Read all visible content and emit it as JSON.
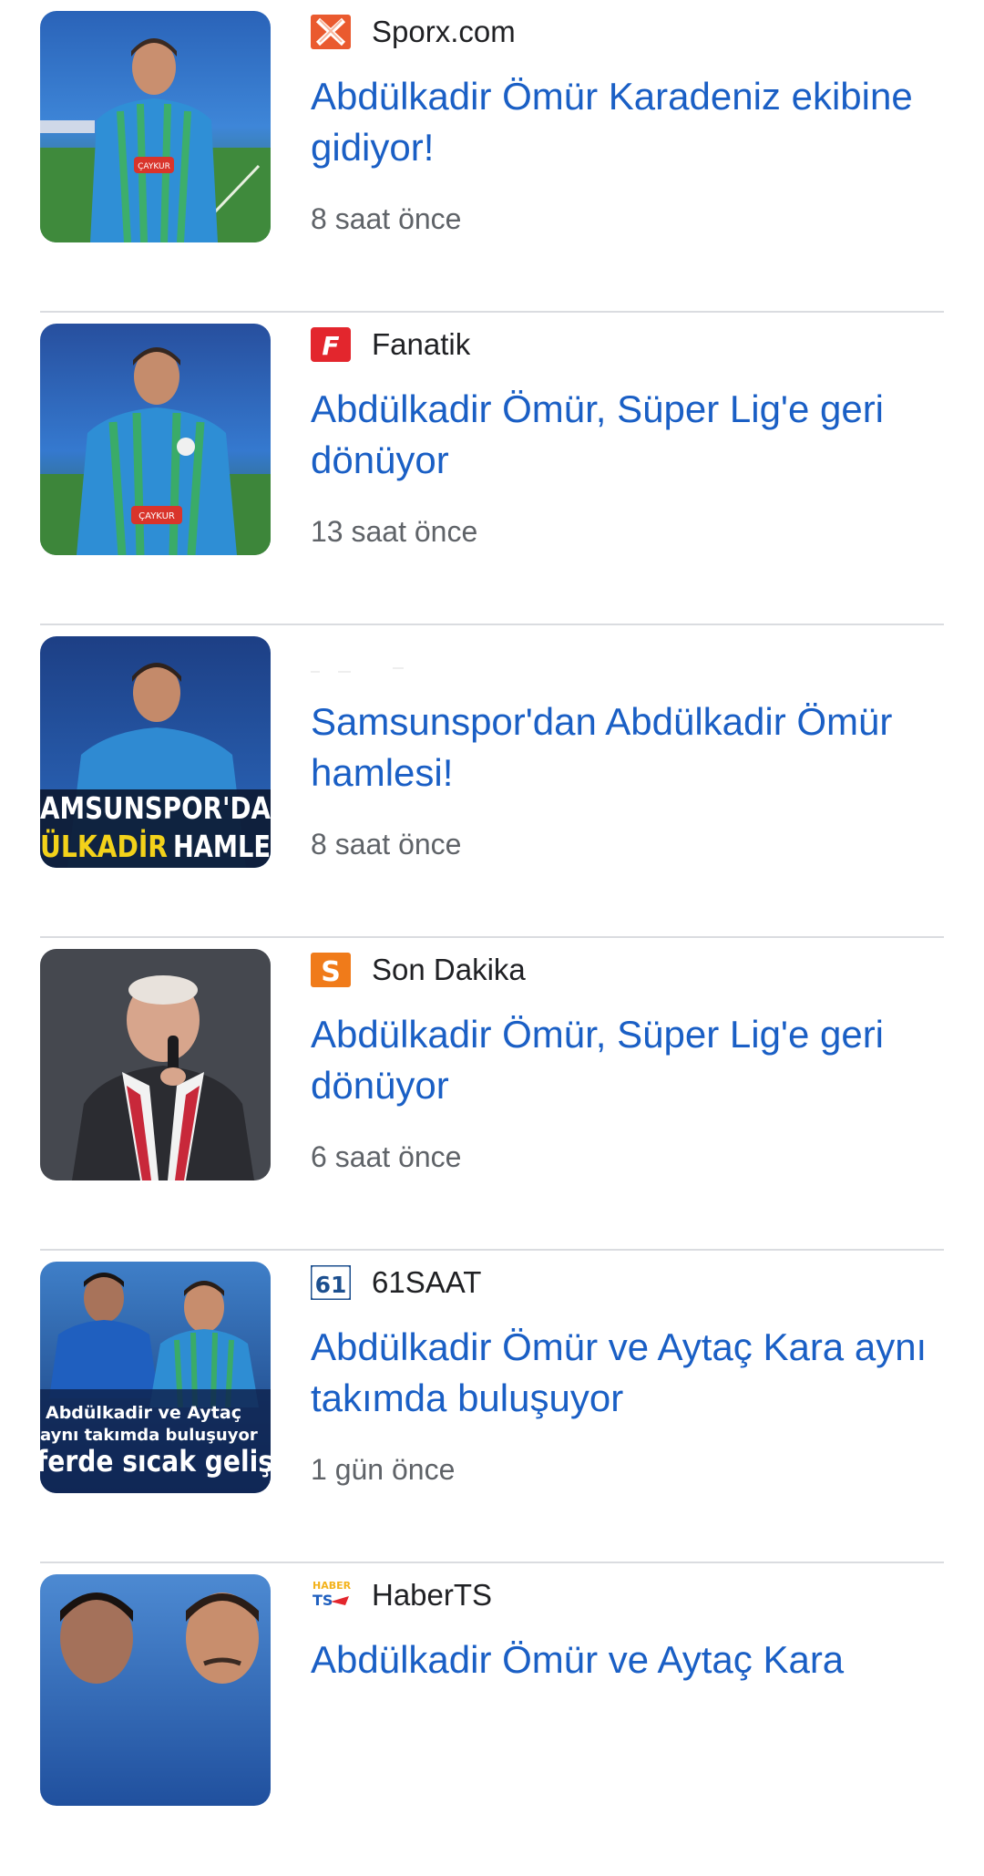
{
  "articles": [
    {
      "source": "Sporx.com",
      "source_icon": "sporx-logo-icon",
      "headline": "Abdülkadir Ömür Karadeniz ekibine gidiyor!",
      "time": "8 saat önce",
      "image": "player-in-blue-green-jersey-image"
    },
    {
      "source": "Fanatik",
      "source_icon": "fanatik-logo-icon",
      "headline": "Abdülkadir Ömür, Süper Lig'e geri dönüyor",
      "time": "13 saat önce",
      "image": "player-in-blue-green-jersey-image"
    },
    {
      "source": "",
      "source_icon": "",
      "headline": "Samsunspor'dan Abdülkadir Ömür hamlesi!",
      "time": "8 saat önce",
      "image": "player-with-banner-text-image",
      "image_text": [
        "AMSUNSPOR'DA",
        "ÜLKADİR",
        "HAMLE"
      ]
    },
    {
      "source": "Son Dakika",
      "source_icon": "son-dakika-logo-icon",
      "headline": "Abdülkadir Ömür, Süper Lig'e geri dönüyor",
      "time": "6 saat önce",
      "image": "speaker-with-microphone-image"
    },
    {
      "source": "61SAAT",
      "source_icon": "61saat-logo-icon",
      "headline": "Abdülkadir Ömür ve Aytaç Kara aynı takımda buluşuyor",
      "time": "1 gün önce",
      "image": "two-players-image",
      "image_text": [
        "Abdülkadir ve Aytaç",
        "aynı takımda buluşuyor",
        "ferde sıcak geliş"
      ]
    },
    {
      "source": "HaberTS",
      "source_icon": "haberts-logo-icon",
      "headline": "Abdülkadir Ömür ve Aytaç Kara",
      "time": "",
      "image": "two-players-image"
    }
  ],
  "colors": {
    "headline": "#1a5fc5",
    "source": "#202124",
    "time": "#5f6368",
    "divider": "#dadce0"
  },
  "logo_text": {
    "fanatik": "F",
    "son_dakika": "S",
    "saat61": "61",
    "haberts_top": "HABER",
    "haberts_bottom": "TS"
  },
  "badge_text": {
    "caykur": "ÇAYKUR"
  }
}
